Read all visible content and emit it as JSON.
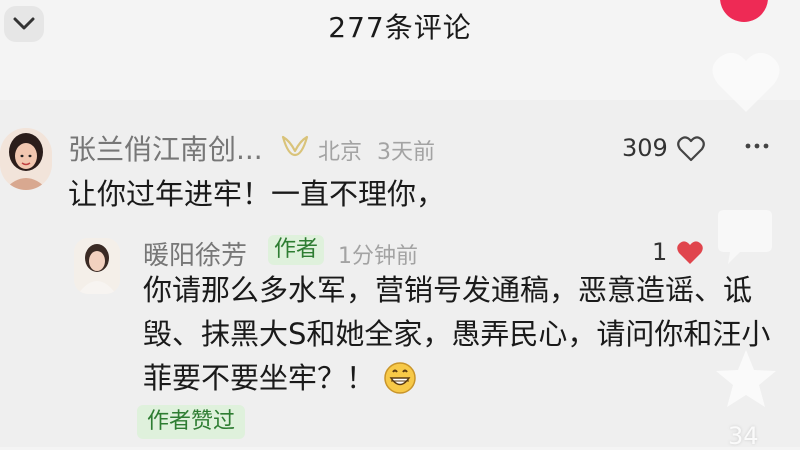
{
  "header": {
    "title": "277条评论"
  },
  "comment": {
    "user": "张兰俏江南创...",
    "location": "北京",
    "time": "3天前",
    "text": "让你过年进牢！一直不理你，",
    "likes": "309"
  },
  "reply": {
    "user": "暖阳徐芳",
    "tag": "作者",
    "time": "1分钟前",
    "text": "你请那么多水军，营销号发通稿，恶意造谣、诋毁、抹黑大S和她全家，愚弄民心，请问你和汪小菲要不要坐牢？！",
    "likes": "1",
    "liked_by_author": "作者赞过"
  },
  "sidebar": {
    "share_count": "34"
  },
  "icons": [
    "chevron-down-icon",
    "verified-badge-icon",
    "heart-outline-icon",
    "heart-filled-icon",
    "grin-emoji-icon",
    "star-icon",
    "like-icon",
    "comment-icon"
  ],
  "colors": {
    "accent_red": "#ee2a55",
    "author_green": "#2e7d32",
    "author_bg": "#dff1dc",
    "heart_red": "#e0454d"
  }
}
